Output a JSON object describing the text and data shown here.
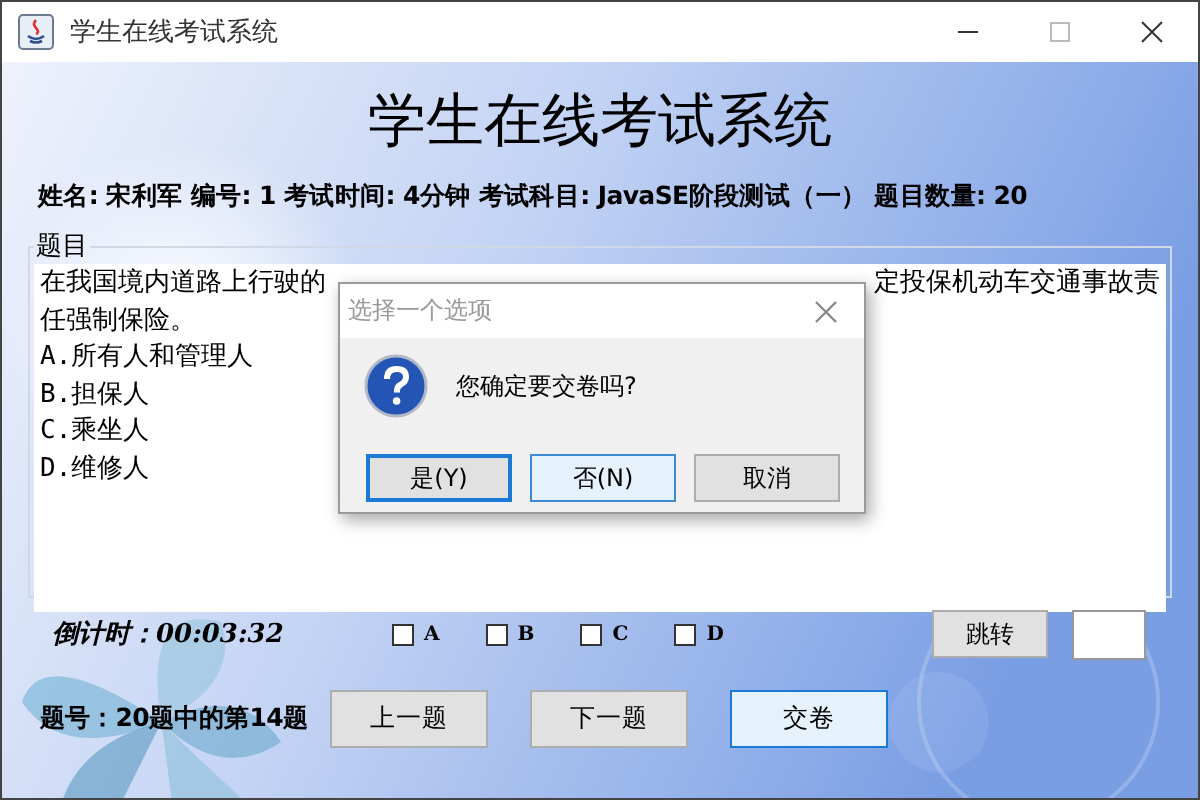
{
  "window": {
    "title": "学生在线考试系统"
  },
  "header": {
    "title": "学生在线考试系统",
    "info": "姓名: 宋利军 编号: 1 考试时间: 4分钟 考试科目: JavaSE阶段测试（一） 题目数量: 20"
  },
  "question": {
    "group_label": "题目",
    "line_1_start": "在我国境内道路上行驶的",
    "line_1_end": "定投保机动车交通事故责",
    "line_2": "任强制保险。",
    "options": [
      "A.所有人和管理人",
      "B.担保人",
      "C.乘坐人",
      "D.维修人"
    ]
  },
  "countdown": "倒计时：00:03:32",
  "answer_checkboxes": [
    {
      "label": "A",
      "checked": false
    },
    {
      "label": "B",
      "checked": false
    },
    {
      "label": "C",
      "checked": false
    },
    {
      "label": "D",
      "checked": false
    }
  ],
  "jump_button": "跳转",
  "question_index": "题号：20题中的第14题",
  "nav_buttons": [
    {
      "label": "上一题",
      "focused": false
    },
    {
      "label": "下一题",
      "focused": false
    },
    {
      "label": "交卷",
      "focused": true
    }
  ],
  "dialog": {
    "title": "选择一个选项",
    "message": "您确定要交卷吗?",
    "buttons": [
      {
        "label": "是(Y)",
        "focused": true,
        "hovered": false
      },
      {
        "label": "否(N)",
        "focused": false,
        "hovered": true
      },
      {
        "label": "取消",
        "focused": false,
        "hovered": false
      }
    ]
  }
}
